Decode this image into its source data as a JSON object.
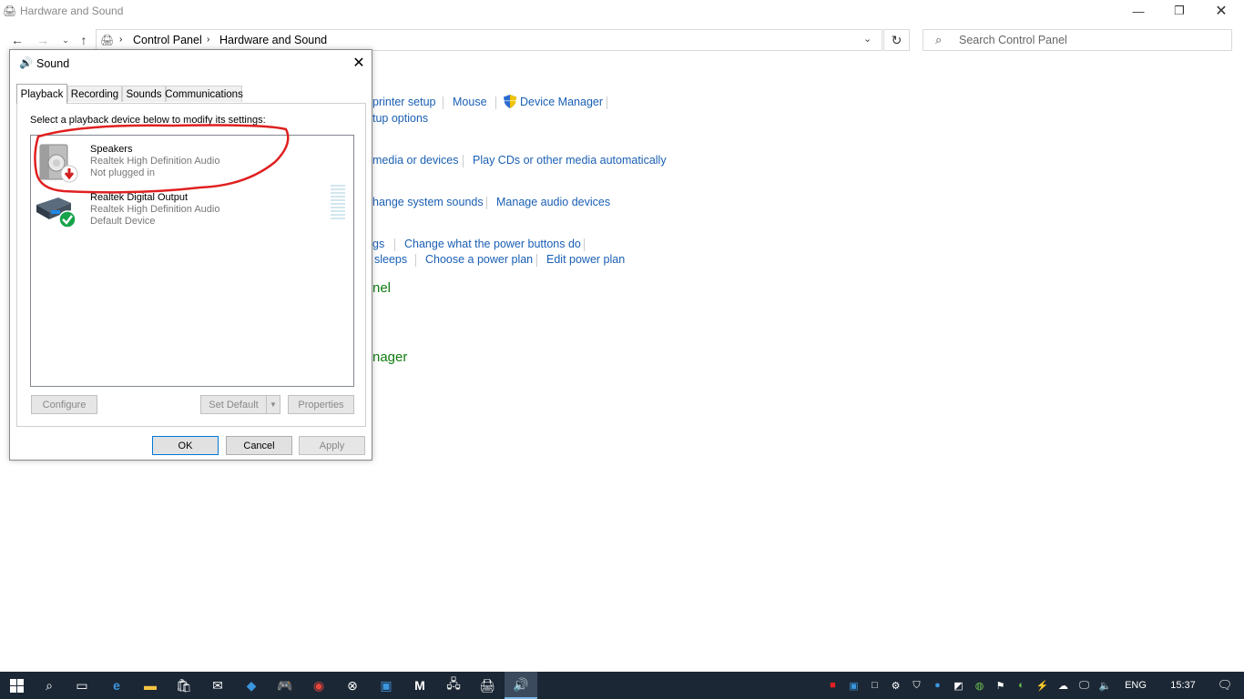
{
  "window": {
    "title": "Hardware and Sound"
  },
  "address": {
    "crumbs": [
      "Control Panel",
      "Hardware and Sound"
    ],
    "search_placeholder": "Search Control Panel"
  },
  "bg_links": {
    "row1": [
      "printer setup",
      "Mouse",
      "Device Manager"
    ],
    "row1b": "tup options",
    "row2": [
      "media or devices",
      "Play CDs or other media automatically"
    ],
    "row3": [
      "hange system sounds",
      "Manage audio devices"
    ],
    "row4": [
      "gs",
      "Change what the power buttons do"
    ],
    "row5": [
      "sleeps",
      "Choose a power plan",
      "Edit power plan"
    ],
    "green1": "nel",
    "green2": "nager"
  },
  "dialog": {
    "title": "Sound",
    "tabs": [
      "Playback",
      "Recording",
      "Sounds",
      "Communications"
    ],
    "instruction": "Select a playback device below to modify its settings:",
    "devices": [
      {
        "name": "Speakers",
        "driver": "Realtek High Definition Audio",
        "status": "Not plugged in"
      },
      {
        "name": "Realtek Digital Output",
        "driver": "Realtek High Definition Audio",
        "status": "Default Device"
      }
    ],
    "buttons": {
      "configure": "Configure",
      "set_default": "Set Default",
      "properties": "Properties",
      "ok": "OK",
      "cancel": "Cancel",
      "apply": "Apply"
    }
  },
  "taskbar": {
    "language": "ENG",
    "time": "15:37"
  },
  "colors": {
    "link": "#1a5fb4",
    "green": "#107c10",
    "taskbar": "#1c2735",
    "annotation": "#e02020"
  }
}
